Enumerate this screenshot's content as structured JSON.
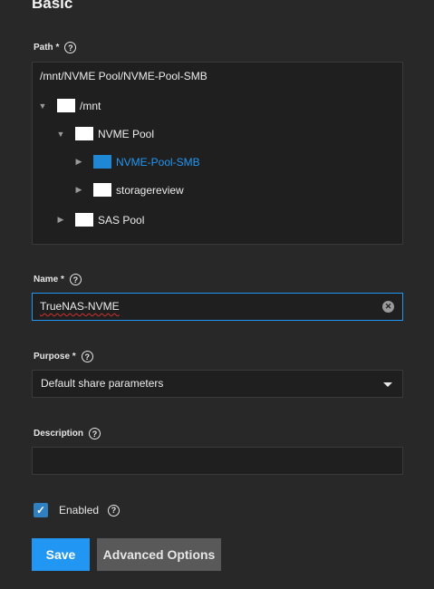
{
  "section": {
    "title": "Basic"
  },
  "path": {
    "label": "Path *",
    "value": "/mnt/NVME Pool/NVME-Pool-SMB",
    "tree": [
      {
        "label": "/mnt",
        "arrow": "▼",
        "selected": false
      },
      {
        "label": "NVME Pool",
        "arrow": "▼",
        "selected": false
      },
      {
        "label": "NVME-Pool-SMB",
        "arrow": "▶",
        "selected": true
      },
      {
        "label": "storagereview",
        "arrow": "▶",
        "selected": false
      },
      {
        "label": "SAS Pool",
        "arrow": "▶",
        "selected": false
      }
    ]
  },
  "name": {
    "label": "Name *",
    "value": "TrueNAS-NVME"
  },
  "purpose": {
    "label": "Purpose *",
    "value": "Default share parameters"
  },
  "description": {
    "label": "Description",
    "value": ""
  },
  "enabled": {
    "label": "Enabled",
    "checked": true
  },
  "buttons": {
    "save": "Save",
    "advanced": "Advanced Options"
  },
  "colors": {
    "accent": "#2196f3",
    "background": "#282828",
    "field": "#1f1f1f"
  },
  "icons": {
    "help": "help-circle-icon",
    "folder": "folder-icon",
    "clear": "clear-icon",
    "caret": "caret-down-icon",
    "check": "checkmark-icon"
  }
}
